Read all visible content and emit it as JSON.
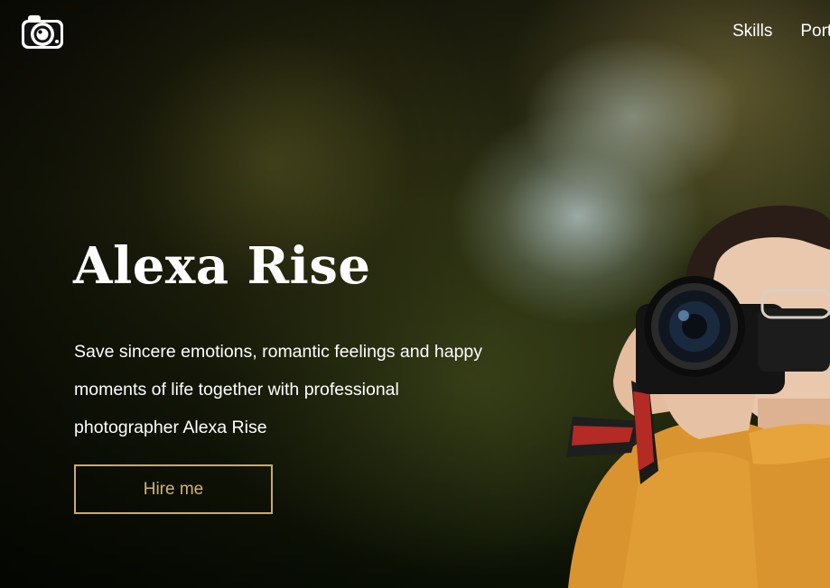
{
  "header": {
    "logo": "camera-logo-icon",
    "nav": [
      {
        "label": "Skills"
      },
      {
        "label": "Portfolio"
      }
    ]
  },
  "hero": {
    "title": "Alexa Rise",
    "tagline": "Save sincere emotions, romantic feelings and happy moments of life together with professional photographer Alexa Rise",
    "cta_label": "Hire me"
  },
  "colors": {
    "accent": "#c7a97a",
    "text": "#ffffff"
  }
}
